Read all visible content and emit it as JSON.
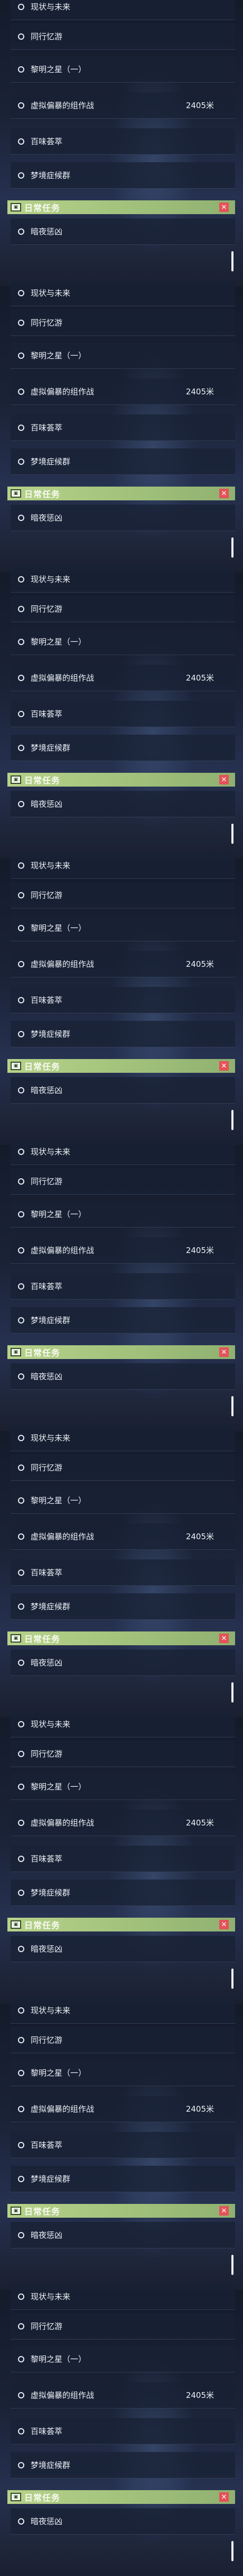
{
  "quest_list": {
    "items": [
      {
        "label": "现状与未来",
        "distance": ""
      },
      {
        "label": "同行忆游",
        "distance": ""
      },
      {
        "label": "黎明之星（一）",
        "distance": ""
      },
      {
        "label": "虚拟偏暴的组作战",
        "distance": "2405米"
      },
      {
        "label": "百味荟萃",
        "distance": ""
      },
      {
        "label": "梦境症候群",
        "distance": ""
      }
    ],
    "section_title": "日常任务",
    "section_icon": "calendar-icon",
    "close_glyph": "✕",
    "after_item": {
      "label": "暗夜惩凶",
      "distance": ""
    }
  },
  "colors": {
    "header_bg": "#a9c884",
    "close_bg": "#e45258",
    "row_bg": "#182134"
  },
  "repeat_count": 9
}
